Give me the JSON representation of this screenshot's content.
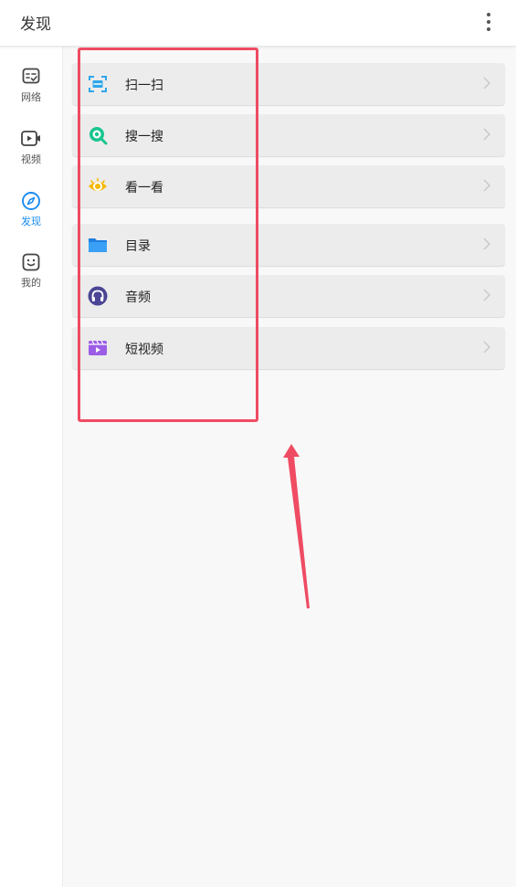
{
  "header": {
    "title": "发现"
  },
  "sidebar": {
    "items": [
      {
        "label": "网络",
        "icon": "network-icon"
      },
      {
        "label": "视频",
        "icon": "video-icon"
      },
      {
        "label": "发现",
        "icon": "compass-icon",
        "active": true
      },
      {
        "label": "我的",
        "icon": "smiley-icon"
      }
    ]
  },
  "rows": [
    {
      "label": "扫一扫",
      "icon": "scan-icon"
    },
    {
      "label": "搜一搜",
      "icon": "search-icon"
    },
    {
      "label": "看一看",
      "icon": "eye-icon"
    },
    {
      "label": "目录",
      "icon": "folder-icon"
    },
    {
      "label": "音频",
      "icon": "headphones-icon"
    },
    {
      "label": "短视频",
      "icon": "short-video-icon"
    }
  ],
  "colors": {
    "accent": "#1a8cf0",
    "highlight": "#ef4b63",
    "row_bg": "#ececec"
  }
}
